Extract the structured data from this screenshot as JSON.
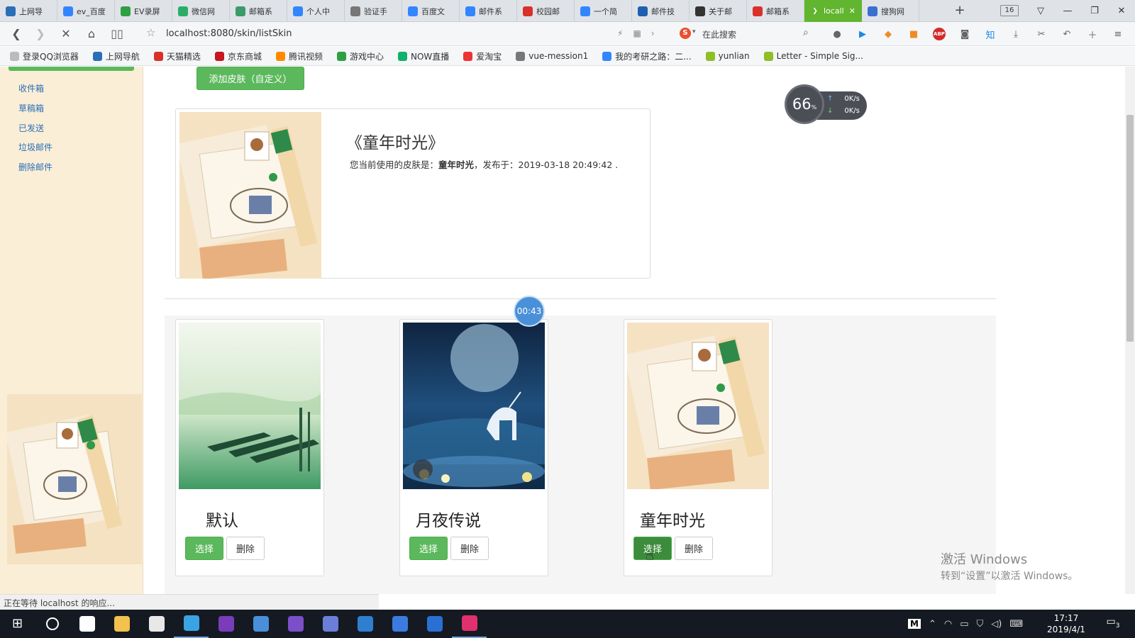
{
  "browser": {
    "tabs": [
      {
        "label": "上网导",
        "icon_color": "#2a6eb8",
        "icon": "e-icon"
      },
      {
        "label": "ev_百度",
        "icon_color": "#3385ff",
        "icon": "baidu-paw-icon"
      },
      {
        "label": "EV录屏",
        "icon_color": "#2ea043",
        "icon": "ev-icon"
      },
      {
        "label": "微信网",
        "icon_color": "#2aae67",
        "icon": "wechat-icon"
      },
      {
        "label": "邮箱系",
        "icon_color": "#3b9b6a",
        "icon": "doc-icon"
      },
      {
        "label": "个人中",
        "icon_color": "#3385ff",
        "icon": "baidu-paw-icon"
      },
      {
        "label": "验证手",
        "icon_color": "#777777",
        "icon": "globe-icon"
      },
      {
        "label": "百度文",
        "icon_color": "#3385ff",
        "icon": "baidu-paw-icon"
      },
      {
        "label": "邮件系",
        "icon_color": "#3385ff",
        "icon": "baidu-paw-icon"
      },
      {
        "label": "校园邮",
        "icon_color": "#d9302a",
        "icon": "c-icon"
      },
      {
        "label": "一个简",
        "icon_color": "#3385ff",
        "icon": "baidu-paw-icon"
      },
      {
        "label": "邮件技",
        "icon_color": "#1f5fb0",
        "icon": "u-icon"
      },
      {
        "label": "关于邮",
        "icon_color": "#333333",
        "icon": "link-icon"
      },
      {
        "label": "邮箱系",
        "icon_color": "#d9302a",
        "icon": "c-icon"
      },
      {
        "label": "locall",
        "icon_color": "#62b52e",
        "icon": "loading-icon",
        "active": true
      },
      {
        "label": "搜狗网",
        "icon_color": "#3a6fd1",
        "icon": "sogou-icon"
      }
    ],
    "new_tab": "+",
    "tab_count": "16",
    "url": "localhost:8080/skin/listSkin",
    "search_placeholder": "在此搜索",
    "bookmarks": [
      {
        "label": "登录QQ浏览器",
        "color": "#bbbbbb"
      },
      {
        "label": "上网导航",
        "color": "#2a6eb8"
      },
      {
        "label": "天猫精选",
        "color": "#d9302a"
      },
      {
        "label": "京东商城",
        "color": "#c81623"
      },
      {
        "label": "腾讯视频",
        "color": "#ff8a00"
      },
      {
        "label": "游戏中心",
        "color": "#2ea043"
      },
      {
        "label": "NOW直播",
        "color": "#12b06a"
      },
      {
        "label": "爱淘宝",
        "color": "#e33"
      },
      {
        "label": "vue-mession1",
        "color": "#777777"
      },
      {
        "label": "我的考研之路：二...",
        "color": "#3385ff"
      },
      {
        "label": "yunlian",
        "color": "#8fbf26"
      },
      {
        "label": "Letter - Simple Sig...",
        "color": "#8fbf26"
      }
    ],
    "status": "正在等待 localhost 的响应..."
  },
  "sidebar": {
    "links": [
      "收件箱",
      "草稿箱",
      "已发送",
      "垃圾邮件",
      "删除邮件"
    ]
  },
  "main": {
    "add_skin_label": "添加皮肤（自定义）",
    "current": {
      "title": "《童年时光》",
      "desc_prefix": "您当前使用的皮肤是：",
      "skin_name": "童年时光",
      "desc_middle": "，发布于：",
      "published": "2019-03-18 20:49:42",
      "desc_suffix": " ."
    },
    "skins": [
      {
        "name": "默认",
        "select_label": "选择",
        "delete_label": "删除"
      },
      {
        "name": "月夜传说",
        "select_label": "选择",
        "delete_label": "删除"
      },
      {
        "name": "童年时光",
        "select_label": "选择",
        "delete_label": "删除"
      }
    ]
  },
  "overlays": {
    "timer": "00:43",
    "speed_percent": "66",
    "speed_unit": "%",
    "upload_speed": "0K/s",
    "download_speed": "0K/s",
    "watermark_title": "激活 Windows",
    "watermark_sub": "转到“设置”以激活 Windows。"
  },
  "taskbar": {
    "apps": [
      {
        "name": "windows-start-icon",
        "color": "#ffffff"
      },
      {
        "name": "cortana-search-icon",
        "color": "#ffffff"
      },
      {
        "name": "store-icon",
        "color": "#ffffff"
      },
      {
        "name": "file-explorer-icon",
        "color": "#f2c14e"
      },
      {
        "name": "tool-app-icon",
        "color": "#e8e8e8"
      },
      {
        "name": "qq-browser-icon",
        "color": "#3aa3e3"
      },
      {
        "name": "onenote-icon",
        "color": "#7a3cb8"
      },
      {
        "name": "app-blue-icon",
        "color": "#4a8fd9"
      },
      {
        "name": "visual-studio-icon",
        "color": "#7b4fc9"
      },
      {
        "name": "app-bird-icon",
        "color": "#6b7fd9"
      },
      {
        "name": "app-vs-code-icon",
        "color": "#2f7fd1"
      },
      {
        "name": "security-shield-icon",
        "color": "#3b7be0"
      },
      {
        "name": "edge-icon",
        "color": "#2a6fd3"
      },
      {
        "name": "intellij-icon",
        "color": "#e0306e"
      }
    ],
    "time": "17:17",
    "date": "2019/4/1",
    "notifications": "3"
  }
}
